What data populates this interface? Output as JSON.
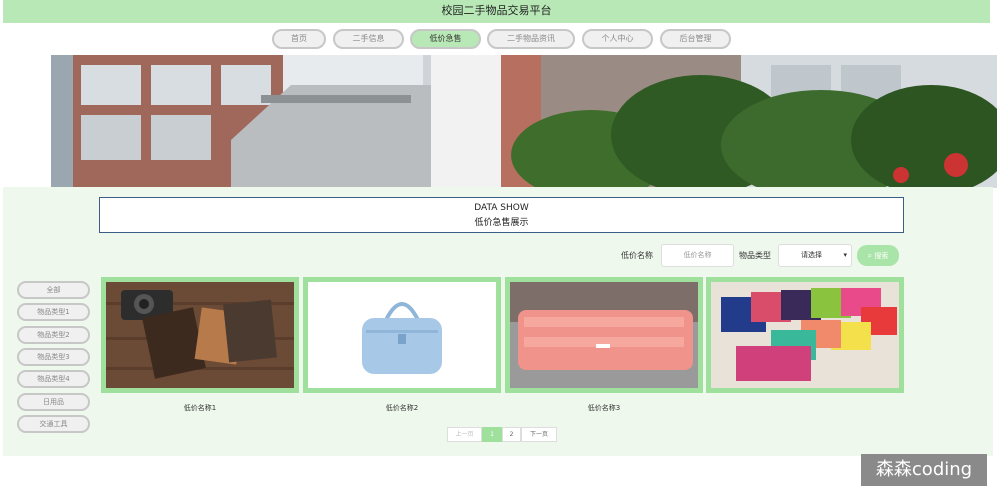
{
  "header": {
    "title": "校园二手物品交易平台"
  },
  "nav": [
    {
      "label": "首页",
      "active": false
    },
    {
      "label": "二手信息",
      "active": false
    },
    {
      "label": "低价急售",
      "active": true
    },
    {
      "label": "二手物品资讯",
      "active": false
    },
    {
      "label": "个人中心",
      "active": false
    },
    {
      "label": "后台管理",
      "active": false
    }
  ],
  "datashow": {
    "title": "DATA SHOW",
    "subtitle": "低价急售展示"
  },
  "search": {
    "name_label": "低价名称",
    "name_placeholder": "低价名称",
    "type_label": "物品类型",
    "type_selected": "请选择",
    "button": "搜索"
  },
  "sidebar": [
    {
      "label": "全部"
    },
    {
      "label": "物品类型1"
    },
    {
      "label": "物品类型2"
    },
    {
      "label": "物品类型3"
    },
    {
      "label": "物品类型4"
    },
    {
      "label": "日用品"
    },
    {
      "label": "交通工具"
    }
  ],
  "products": [
    {
      "name": "低价名称1"
    },
    {
      "name": "低价名称2"
    },
    {
      "name": "低价名称3"
    },
    {
      "name": ""
    }
  ],
  "pager": {
    "prev": "上一页",
    "pages": [
      "1",
      "2"
    ],
    "current": "1",
    "next": "下一页"
  },
  "watermark": "森森coding"
}
